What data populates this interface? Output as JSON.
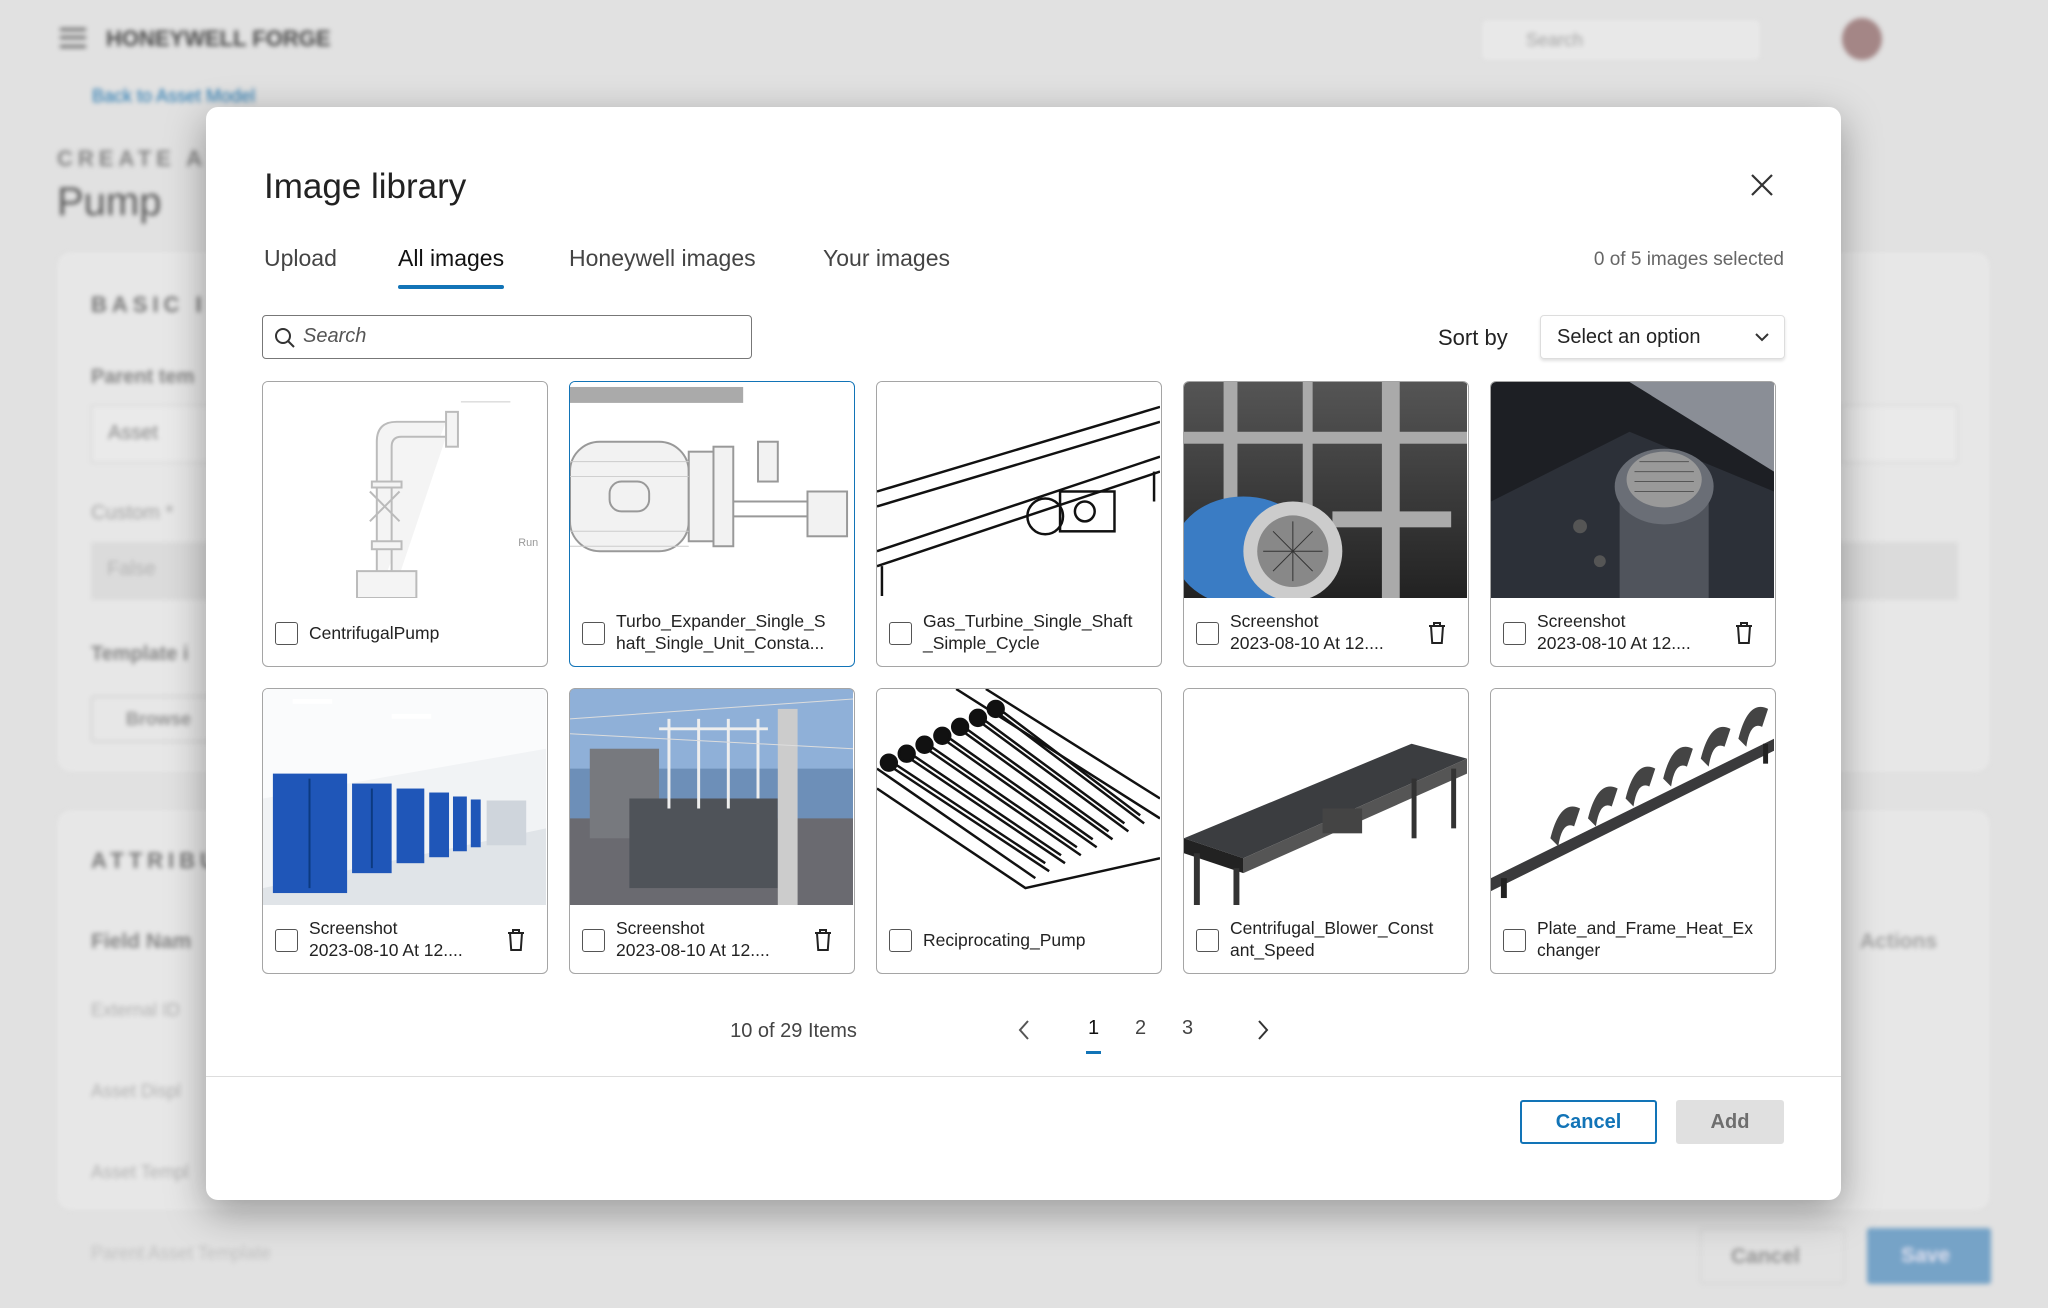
{
  "background": {
    "brand": "HONEYWELL FORGE",
    "search_placeholder": "Search",
    "back_link": "Back to Asset Model",
    "create_label": "CREATE A",
    "page_title": "Pump",
    "section_basic": "BASIC I",
    "parent_label": "Parent tem",
    "parent_value": "Asset",
    "custom_label": "Custom  *",
    "custom_value": "False",
    "template_label": "Template i",
    "browse_button": "Browse",
    "section_attributes": "ATTRIBU",
    "field_name_header": "Field Nam",
    "actions_header": "Actions",
    "rows": [
      "External ID",
      "Asset Displ",
      "Asset Templ",
      "Parent Asset Template"
    ],
    "footer_cancel": "Cancel",
    "footer_save": "Save",
    "accent": "#1274b7"
  },
  "modal": {
    "title": "Image library",
    "tabs": [
      {
        "label": "Upload",
        "active": false
      },
      {
        "label": "All images",
        "active": true
      },
      {
        "label": "Honeywell images",
        "active": false
      },
      {
        "label": "Your images",
        "active": false
      }
    ],
    "selection_count": "0 of 5 images selected",
    "search_placeholder": "Search",
    "sort_label": "Sort by",
    "sort_value": "Select an option",
    "images": [
      {
        "lines": [
          "CentrifugalPump"
        ],
        "thumb": "pump-drawing",
        "delete": false,
        "highlighted": false
      },
      {
        "lines": [
          "Turbo_Expander_Single_S",
          "haft_Single_Unit_Consta..."
        ],
        "thumb": "expander-drawing",
        "delete": false,
        "highlighted": true
      },
      {
        "lines": [
          "Gas_Turbine_Single_Shaft",
          "_Simple_Cycle"
        ],
        "thumb": "turbine-drawing",
        "delete": false,
        "highlighted": false
      },
      {
        "lines": [
          "Screenshot",
          "2023-08-10 At 12...."
        ],
        "thumb": "photo-machinery",
        "delete": true,
        "highlighted": false
      },
      {
        "lines": [
          "Screenshot",
          "2023-08-10 At 12...."
        ],
        "thumb": "photo-motor",
        "delete": true,
        "highlighted": false
      },
      {
        "lines": [
          "Screenshot",
          "2023-08-10 At 12...."
        ],
        "thumb": "photo-lab",
        "delete": true,
        "highlighted": false
      },
      {
        "lines": [
          "Screenshot",
          "2023-08-10 At 12...."
        ],
        "thumb": "photo-substation",
        "delete": true,
        "highlighted": false
      },
      {
        "lines": [
          "Reciprocating_Pump"
        ],
        "thumb": "roller-drawing",
        "delete": false,
        "highlighted": false
      },
      {
        "lines": [
          "Centrifugal_Blower_Const",
          "ant_Speed"
        ],
        "thumb": "conveyor-3d",
        "delete": false,
        "highlighted": false
      },
      {
        "lines": [
          "Plate_and_Frame_Heat_Ex",
          "changer"
        ],
        "thumb": "chain-conveyor",
        "delete": false,
        "highlighted": false
      }
    ],
    "pagination": {
      "summary": "10 of 29 Items",
      "pages": [
        "1",
        "2",
        "3"
      ],
      "current": "1"
    },
    "cancel_label": "Cancel",
    "add_label": "Add"
  }
}
